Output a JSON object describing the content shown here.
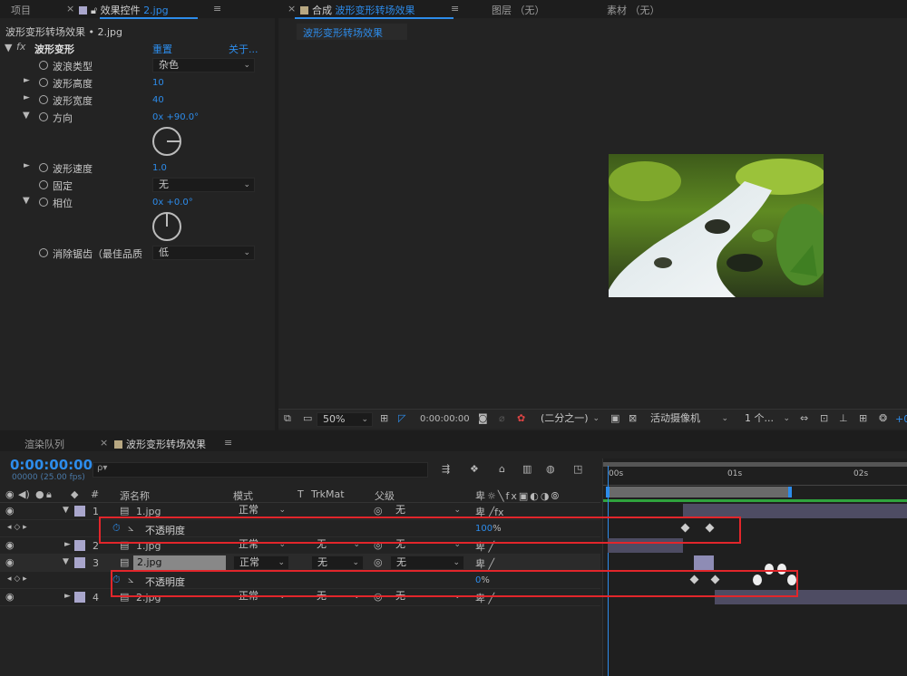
{
  "left_panel": {
    "tab_project": "项目",
    "tab_effect_controls_prefix": "效果控件",
    "tab_effect_controls_file": "2.jpg",
    "header": "波形变形转场效果 • 2.jpg",
    "effect_name": "波形变形",
    "reset": "重置",
    "about": "关于...",
    "props": [
      {
        "label": "波浪类型",
        "value": "杂色",
        "kind": "dropdown"
      },
      {
        "label": "波形高度",
        "value": "10",
        "kind": "number"
      },
      {
        "label": "波形宽度",
        "value": "40",
        "kind": "number"
      },
      {
        "label": "方向",
        "value": "0x +90.0°",
        "kind": "angle"
      },
      {
        "label": "波形速度",
        "value": "1.0",
        "kind": "number"
      },
      {
        "label": "固定",
        "value": "无",
        "kind": "dropdown"
      },
      {
        "label": "相位",
        "value": "0x +0.0°",
        "kind": "angle"
      },
      {
        "label": "消除锯齿（最佳品质",
        "value": "低",
        "kind": "dropdown"
      }
    ]
  },
  "viewer": {
    "tab_comp_prefix": "合成",
    "tab_comp_name": "波形变形转场效果",
    "tab_layer": "图层 （无）",
    "tab_footage": "素材 （无）",
    "subtab": "波形变形转场效果",
    "zoom": "50%",
    "timecode": "0:00:00:00",
    "resolution": "(二分之一)",
    "camera": "活动摄像机",
    "views": "1 个...",
    "offset": "+0"
  },
  "timeline": {
    "tab_render": "渲染队列",
    "tab_comp": "波形变形转场效果",
    "timecode": "0:00:00:00",
    "fps": "00000 (25.00 fps)",
    "search_placeholder": "ρ▾",
    "columns": {
      "num": "#",
      "source": "源名称",
      "mode": "模式",
      "t": "T",
      "trkmat": "TrkMat",
      "parent": "父级"
    },
    "ruler": [
      "00s",
      "01s",
      "02s"
    ],
    "layers": [
      {
        "num": "1",
        "name": "1.jpg",
        "mode": "正常",
        "trkmat": "",
        "parent": "无"
      },
      {
        "num": "2",
        "name": "1.jpg",
        "mode": "正常",
        "trkmat": "无",
        "parent": "无"
      },
      {
        "num": "3",
        "name": "2.jpg",
        "mode": "正常",
        "trkmat": "无",
        "parent": "无"
      },
      {
        "num": "4",
        "name": "2.jpg",
        "mode": "正常",
        "trkmat": "无",
        "parent": "无"
      }
    ],
    "opacity_rows": [
      {
        "label": "不透明度",
        "value": "100",
        "unit": "%"
      },
      {
        "label": "不透明度",
        "value": "0",
        "unit": "%"
      }
    ]
  },
  "colors": {
    "accent": "#2d8ceb",
    "label": "#a9a6cc",
    "highlight": "#e2262b"
  }
}
